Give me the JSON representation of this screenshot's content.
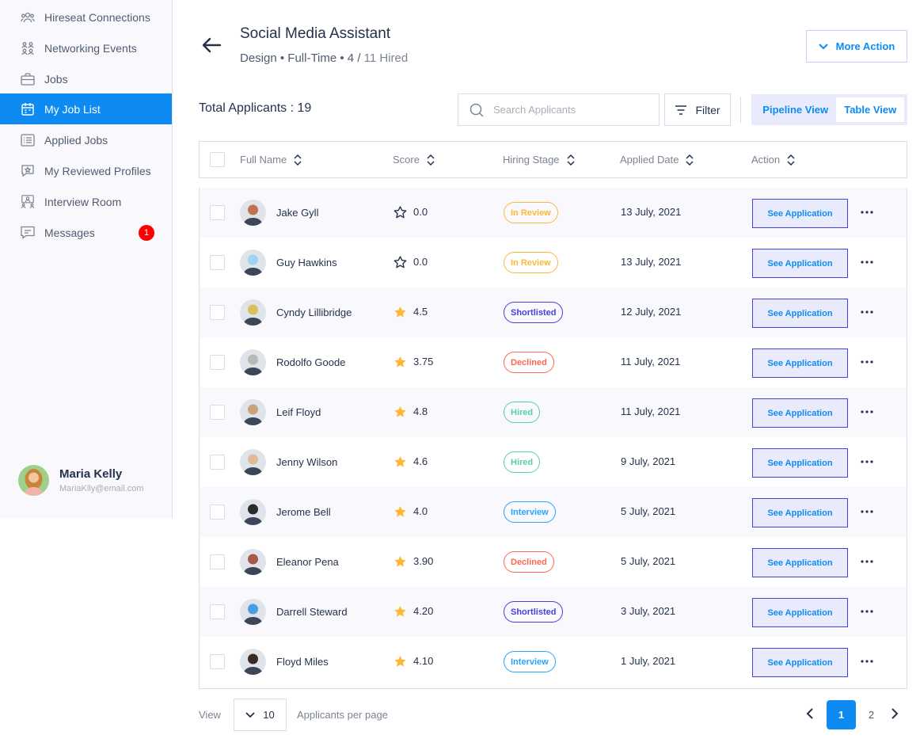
{
  "sidebar": {
    "items": [
      {
        "label": "Hireseat Connections",
        "icon": "people-icon"
      },
      {
        "label": "Networking Events",
        "icon": "network-icon"
      },
      {
        "label": "Jobs",
        "icon": "briefcase-icon"
      },
      {
        "label": "My Job List",
        "icon": "calendar-icon",
        "active": true
      },
      {
        "label": "Applied Jobs",
        "icon": "list-icon"
      },
      {
        "label": "My Reviewed Profiles",
        "icon": "star-chat-icon"
      },
      {
        "label": "Interview Room",
        "icon": "interview-icon"
      },
      {
        "label": "Messages",
        "icon": "message-icon"
      }
    ],
    "messages_badge": "1",
    "user": {
      "name": "Maria Kelly",
      "email": "MariaKlly@email.com"
    }
  },
  "header": {
    "title": "Social Media Assistant",
    "subtitle_main": "Design • Full-Time • 4 / ",
    "subtitle_hired": "11 Hired",
    "more_action": "More Action"
  },
  "toolbar": {
    "total_applicants": "Total Applicants : 19",
    "search_placeholder": "Search Applicants",
    "filter": "Filter",
    "pipeline_view": "Pipeline View",
    "table_view": "Table View"
  },
  "table": {
    "headers": [
      "Full Name",
      "Score",
      "Hiring Stage",
      "Applied Date",
      "Action"
    ],
    "action_label": "See Application",
    "rows": [
      {
        "name": "Jake Gyll",
        "score": "0.0",
        "starred": false,
        "stage": "In Review",
        "date": "13 July, 2021"
      },
      {
        "name": "Guy Hawkins",
        "score": "0.0",
        "starred": false,
        "stage": "In Review",
        "date": "13 July, 2021"
      },
      {
        "name": "Cyndy Lillibridge",
        "score": "4.5",
        "starred": true,
        "stage": "Shortlisted",
        "date": "12 July, 2021"
      },
      {
        "name": "Rodolfo Goode",
        "score": "3.75",
        "starred": true,
        "stage": "Declined",
        "date": "11 July, 2021"
      },
      {
        "name": "Leif Floyd",
        "score": "4.8",
        "starred": true,
        "stage": "Hired",
        "date": "11 July, 2021"
      },
      {
        "name": "Jenny Wilson",
        "score": "4.6",
        "starred": true,
        "stage": "Hired",
        "date": "9 July, 2021"
      },
      {
        "name": "Jerome Bell",
        "score": "4.0",
        "starred": true,
        "stage": "Interview",
        "date": "5 July, 2021"
      },
      {
        "name": "Eleanor Pena",
        "score": "3.90",
        "starred": true,
        "stage": "Declined",
        "date": "5 July, 2021"
      },
      {
        "name": "Darrell Steward",
        "score": "4.20",
        "starred": true,
        "stage": "Shortlisted",
        "date": "3 July, 2021"
      },
      {
        "name": "Floyd Miles",
        "score": "4.10",
        "starred": true,
        "stage": "Interview",
        "date": "1 July, 2021"
      }
    ]
  },
  "stage_colors": {
    "In Review": "#ffb836",
    "Shortlisted": "#4640de",
    "Declined": "#ff6550",
    "Hired": "#56cdad",
    "Interview": "#26a4ff"
  },
  "avatar_colors": [
    "#c0714f",
    "#9fd3f0",
    "#d8c15a",
    "#b8b8b8",
    "#c9a27e",
    "#e0b89a",
    "#2b2b2b",
    "#a8584b",
    "#4a9de0",
    "#3a2a20"
  ],
  "footer": {
    "view_label": "View",
    "per_page": "10",
    "per_page_label": "Applicants per page",
    "pages": [
      "1",
      "2"
    ]
  },
  "colors": {
    "accent": "#0d8bf2",
    "star": "#ffb836"
  }
}
